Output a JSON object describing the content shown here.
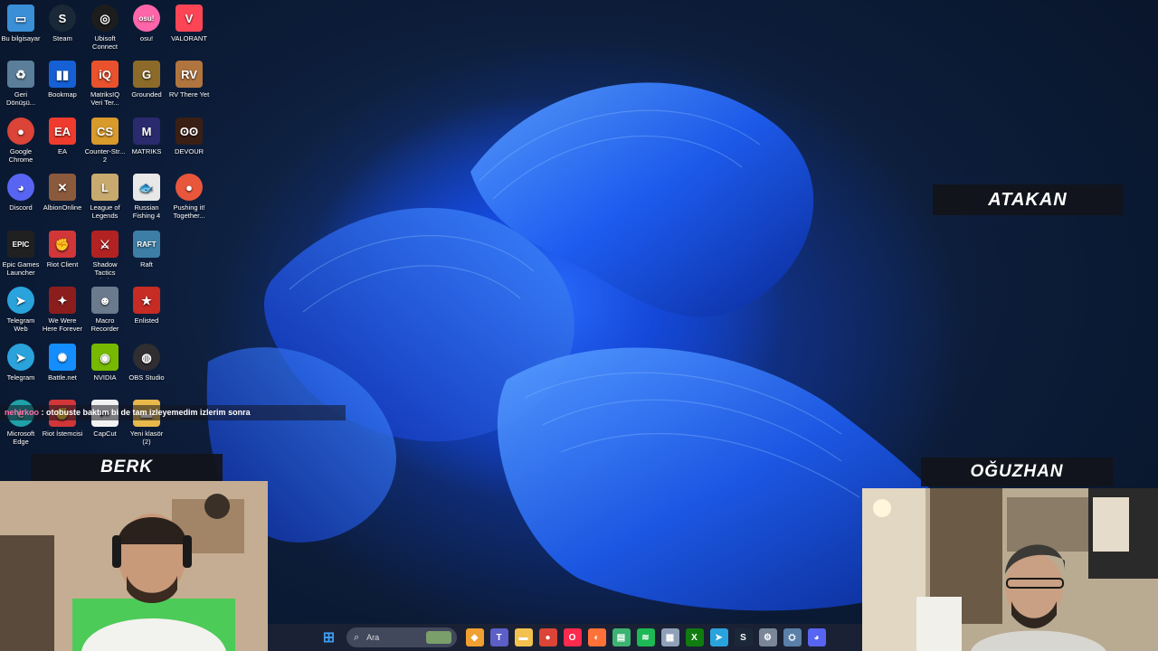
{
  "desktop": {
    "icons": [
      {
        "label": "Bu bilgisayar",
        "icon": "monitor-icon",
        "color": "#3a8fd6",
        "glyph": "▭"
      },
      {
        "label": "Steam",
        "icon": "steam-icon",
        "color": "#1b2838",
        "glyph": "S"
      },
      {
        "label": "Ubisoft Connect",
        "icon": "ubisoft-icon",
        "color": "#1d1d1d",
        "glyph": "◎"
      },
      {
        "label": "osu!",
        "icon": "osu-icon",
        "color": "#ff66aa",
        "glyph": "osu!"
      },
      {
        "label": "VALORANT",
        "icon": "valorant-icon",
        "color": "#fd4556",
        "glyph": "V"
      },
      {
        "label": "Geri Dönüşü...",
        "icon": "recycle-bin-icon",
        "color": "#5b7e9a",
        "glyph": "♻"
      },
      {
        "label": "Bookmap",
        "icon": "bookmap-icon",
        "color": "#1560d4",
        "glyph": "▮▮"
      },
      {
        "label": "MatriksIQ Veri Ter...",
        "icon": "matriksiq-icon",
        "color": "#e9522c",
        "glyph": "iQ"
      },
      {
        "label": "Grounded",
        "icon": "grounded-icon",
        "color": "#8c6b2a",
        "glyph": "G"
      },
      {
        "label": "RV There Yet",
        "icon": "rv-there-yet-icon",
        "color": "#b0743f",
        "glyph": "RV"
      },
      {
        "label": "Google Chrome",
        "icon": "chrome-icon",
        "color": "#db4437",
        "glyph": "●"
      },
      {
        "label": "EA",
        "icon": "ea-icon",
        "color": "#ef3b2d",
        "glyph": "EA"
      },
      {
        "label": "Counter-Str... 2",
        "icon": "counter-strike-icon",
        "color": "#d89a2b",
        "glyph": "CS"
      },
      {
        "label": "MATRIKS",
        "icon": "matriks-icon",
        "color": "#2a2a6e",
        "glyph": "M"
      },
      {
        "label": "DEVOUR",
        "icon": "devour-icon",
        "color": "#3a1f14",
        "glyph": "ʘʘ"
      },
      {
        "label": "Discord",
        "icon": "discord-icon",
        "color": "#5865f2",
        "glyph": "◕"
      },
      {
        "label": "AlbionOnline",
        "icon": "albion-online-icon",
        "color": "#8b5a3c",
        "glyph": "✕"
      },
      {
        "label": "League of Legends",
        "icon": "league-of-legends-icon",
        "color": "#c8aa6e",
        "glyph": "L"
      },
      {
        "label": "Russian Fishing 4",
        "icon": "russian-fishing-icon",
        "color": "#e8e8e8",
        "glyph": "🐟"
      },
      {
        "label": "Pushing it! Together...",
        "icon": "pushing-it-together-icon",
        "color": "#e8563c",
        "glyph": "●"
      },
      {
        "label": "Epic Games Launcher",
        "icon": "epic-games-icon",
        "color": "#202020",
        "glyph": "EPIC"
      },
      {
        "label": "Riot Client",
        "icon": "riot-client-icon",
        "color": "#d13639",
        "glyph": "✊"
      },
      {
        "label": "Shadow Tactics Blad...",
        "icon": "shadow-tactics-icon",
        "color": "#b22222",
        "glyph": "⚔"
      },
      {
        "label": "Raft",
        "icon": "raft-icon",
        "color": "#3c7ea6",
        "glyph": "RAFT"
      },
      {
        "label": "Telegram Web",
        "icon": "telegram-web-icon",
        "color": "#2aa3dd",
        "glyph": "➤"
      },
      {
        "label": "We Were Here Forever",
        "icon": "we-were-here-icon",
        "color": "#8c1d1d",
        "glyph": "✦"
      },
      {
        "label": "Macro Recorder",
        "icon": "macro-recorder-icon",
        "color": "#6b7a8c",
        "glyph": "☻"
      },
      {
        "label": "Enlisted",
        "icon": "enlisted-icon",
        "color": "#c62b24",
        "glyph": "★"
      },
      {
        "label": "Telegram",
        "icon": "telegram-icon",
        "color": "#2aa3dd",
        "glyph": "➤"
      },
      {
        "label": "Battle.net",
        "icon": "battlenet-icon",
        "color": "#148eff",
        "glyph": "✺"
      },
      {
        "label": "NVIDIA",
        "icon": "nvidia-icon",
        "color": "#76b900",
        "glyph": "◉"
      },
      {
        "label": "OBS Studio",
        "icon": "obs-studio-icon",
        "color": "#302e31",
        "glyph": "◍"
      },
      {
        "label": "Microsoft Edge",
        "icon": "edge-icon",
        "color": "#1fa1a7",
        "glyph": "e"
      },
      {
        "label": "Riot İstemcisi",
        "icon": "riot-istemcisi-icon",
        "color": "#d13639",
        "glyph": "✊"
      },
      {
        "label": "CapCut",
        "icon": "capcut-icon",
        "color": "#f2f2f2",
        "glyph": "✂"
      },
      {
        "label": "Yeni klasör (2)",
        "icon": "folder-icon",
        "color": "#e8b84a",
        "glyph": "▬"
      }
    ]
  },
  "chat": {
    "user": "nehirkoo",
    "message": " : otobuste baktım bi de tam izleyemedim izlerim sonra"
  },
  "names": {
    "atakan": "ATAKAN",
    "berk": "BERK",
    "oguzhan": "OĞUZHAN"
  },
  "taskbar": {
    "search_placeholder": "Ara",
    "apps": [
      {
        "icon": "start-windows-icon",
        "color": "#3b9cf0",
        "glyph": "⊞"
      },
      {
        "icon": "copilot-icon",
        "color": "#f0a030",
        "glyph": "◆"
      },
      {
        "icon": "teams-icon",
        "color": "#5b5fc7",
        "glyph": "T"
      },
      {
        "icon": "file-explorer-icon",
        "color": "#f2c14e",
        "glyph": "▬"
      },
      {
        "icon": "chrome-icon",
        "color": "#db4437",
        "glyph": "●"
      },
      {
        "icon": "opera-gx-icon",
        "color": "#ff2a4d",
        "glyph": "O"
      },
      {
        "icon": "firefox-icon",
        "color": "#ff7139",
        "glyph": "◐"
      },
      {
        "icon": "notepad-icon",
        "color": "#3cb371",
        "glyph": "▤"
      },
      {
        "icon": "spotify-icon",
        "color": "#1db954",
        "glyph": "≋"
      },
      {
        "icon": "task-view-icon",
        "color": "#8fa0b8",
        "glyph": "▦"
      },
      {
        "icon": "xbox-icon",
        "color": "#107c10",
        "glyph": "X"
      },
      {
        "icon": "telegram-icon",
        "color": "#2aa3dd",
        "glyph": "➤"
      },
      {
        "icon": "steam-icon",
        "color": "#1b2838",
        "glyph": "S"
      },
      {
        "icon": "settings-icon",
        "color": "#7a8797",
        "glyph": "⚙"
      },
      {
        "icon": "network-icon",
        "color": "#5a7fa8",
        "glyph": "⛭"
      },
      {
        "icon": "discord-icon",
        "color": "#5865f2",
        "glyph": "◕"
      }
    ]
  }
}
